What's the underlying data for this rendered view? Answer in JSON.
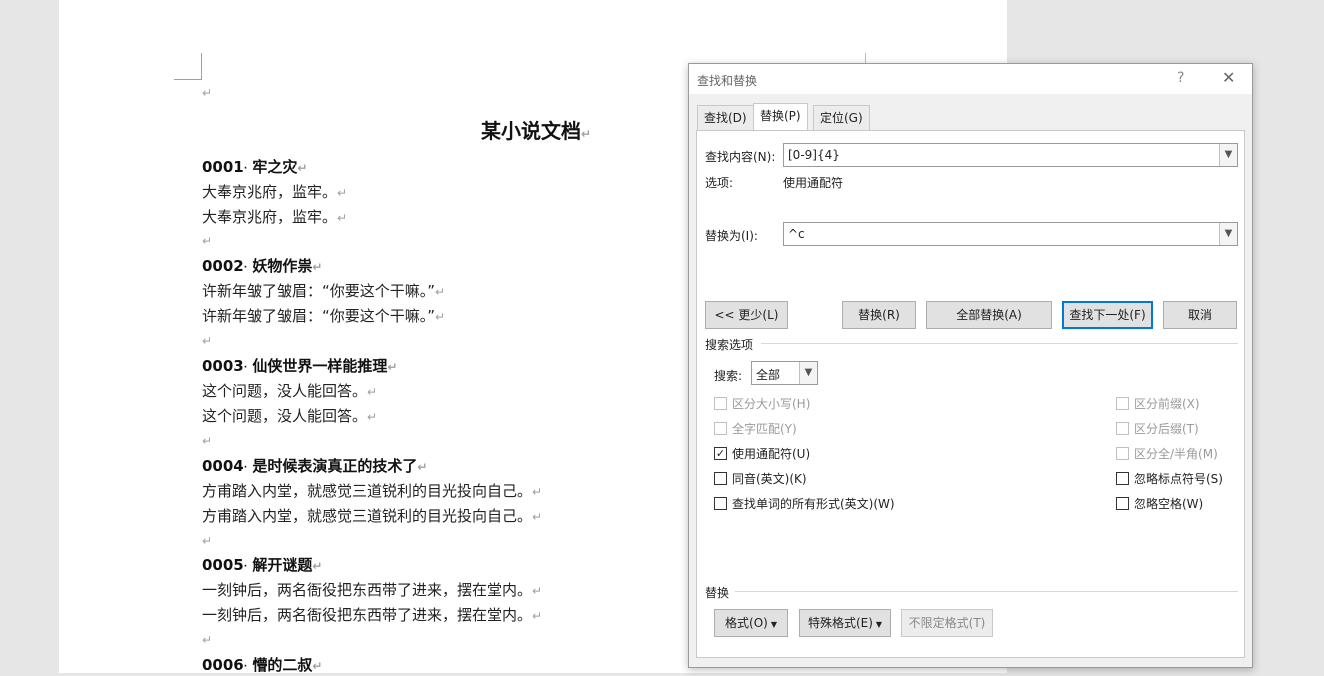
{
  "document": {
    "title": "某小说文档",
    "para_mark": "↵",
    "lines": [
      {
        "kind": "empty"
      },
      {
        "kind": "heading",
        "num": "0001",
        "text": "牢之灾"
      },
      {
        "kind": "text",
        "text": "大奉京兆府，监牢。"
      },
      {
        "kind": "text",
        "text": "大奉京兆府，监牢。"
      },
      {
        "kind": "empty"
      },
      {
        "kind": "heading",
        "num": "0002",
        "text": "妖物作祟"
      },
      {
        "kind": "text",
        "text": "许新年皱了皱眉：“你要这个干嘛。”"
      },
      {
        "kind": "text",
        "text": "许新年皱了皱眉：“你要这个干嘛。”"
      },
      {
        "kind": "empty"
      },
      {
        "kind": "heading",
        "num": "0003",
        "text": "仙侠世界一样能推理"
      },
      {
        "kind": "text",
        "text": "这个问题，没人能回答。"
      },
      {
        "kind": "text",
        "text": "这个问题，没人能回答。"
      },
      {
        "kind": "empty"
      },
      {
        "kind": "heading",
        "num": "0004",
        "text": "是时候表演真正的技术了"
      },
      {
        "kind": "text",
        "text": "方甫踏入内堂，就感觉三道锐利的目光投向自己。"
      },
      {
        "kind": "text",
        "text": "方甫踏入内堂，就感觉三道锐利的目光投向自己。"
      },
      {
        "kind": "empty"
      },
      {
        "kind": "heading",
        "num": "0005",
        "text": "解开谜题"
      },
      {
        "kind": "text",
        "text": "一刻钟后，两名衙役把东西带了进来，摆在堂内。"
      },
      {
        "kind": "text",
        "text": "一刻钟后，两名衙役把东西带了进来，摆在堂内。"
      },
      {
        "kind": "empty"
      },
      {
        "kind": "heading",
        "num": "0006",
        "text": "懵的二叔"
      }
    ]
  },
  "dialog": {
    "title": "查找和替换",
    "help": "?",
    "close": "✕",
    "tabs": [
      "查找(D)",
      "替换(P)",
      "定位(G)"
    ],
    "find_label": "查找内容(N):",
    "find_value": "[0-9]{4}",
    "options_label": "选项:",
    "options_value": "使用通配符",
    "replace_label": "替换为(I):",
    "replace_value": "^c",
    "buttons": {
      "less": "<< 更少(L)",
      "replace": "替换(R)",
      "replace_all": "全部替换(A)",
      "find_next": "查找下一处(F)",
      "cancel": "取消"
    },
    "search_options_title": "搜索选项",
    "search_label": "搜索:",
    "search_value": "全部",
    "checkboxes_left": [
      {
        "label": "区分大小写(H)",
        "checked": false,
        "disabled": true
      },
      {
        "label": "全字匹配(Y)",
        "checked": false,
        "disabled": true
      },
      {
        "label": "使用通配符(U)",
        "checked": true,
        "disabled": false
      },
      {
        "label": "同音(英文)(K)",
        "checked": false,
        "disabled": false
      },
      {
        "label": "查找单词的所有形式(英文)(W)",
        "checked": false,
        "disabled": false
      }
    ],
    "checkboxes_right": [
      {
        "label": "区分前缀(X)",
        "checked": false,
        "disabled": true
      },
      {
        "label": "区分后缀(T)",
        "checked": false,
        "disabled": true
      },
      {
        "label": "区分全/半角(M)",
        "checked": false,
        "disabled": true
      },
      {
        "label": "忽略标点符号(S)",
        "checked": false,
        "disabled": false
      },
      {
        "label": "忽略空格(W)",
        "checked": false,
        "disabled": false
      }
    ],
    "replace_section_title": "替换",
    "format_buttons": {
      "format": "格式(O)",
      "special": "特殊格式(E)",
      "no_format": "不限定格式(T)"
    },
    "check_glyph": "✓"
  }
}
